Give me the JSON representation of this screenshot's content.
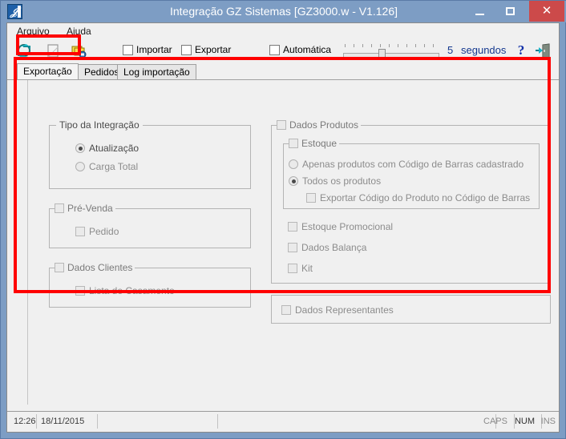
{
  "window": {
    "title": "Integração GZ Sistemas [GZ3000.w - V1.126]",
    "icon": "app-icon",
    "minimize_label": "",
    "maximize_label": "",
    "close_label": "✕"
  },
  "menu": {
    "items": [
      {
        "label": "Arquivo"
      },
      {
        "label": "Ajuda"
      }
    ]
  },
  "toolbar": {
    "icons": [
      {
        "name": "sync-icon"
      },
      {
        "name": "note-icon"
      },
      {
        "name": "copy-icon"
      }
    ],
    "checkboxes": [
      {
        "label": "Importar",
        "checked": false
      },
      {
        "label": "Exportar",
        "checked": false
      },
      {
        "label": "Automática",
        "checked": false
      }
    ],
    "slider": {
      "value": 5,
      "min": 1,
      "max": 12
    },
    "seconds_value": "5",
    "seconds_label": "segundos",
    "help_label": "?",
    "exit_label": ""
  },
  "tabs": [
    {
      "label": "Exportação",
      "active": true
    },
    {
      "label": "Pedidos",
      "active": false
    },
    {
      "label": "Log importação",
      "active": false
    }
  ],
  "exportacao": {
    "tipo_integracao": {
      "legend": "Tipo da Integração",
      "options": [
        {
          "label": "Atualização",
          "selected": true
        },
        {
          "label": "Carga Total",
          "selected": false
        }
      ]
    },
    "pre_venda": {
      "legend": "Pré-Venda",
      "checked": false,
      "options": [
        {
          "label": "Pedido",
          "checked": false
        }
      ]
    },
    "dados_clientes": {
      "legend": "Dados Clientes",
      "checked": false,
      "options": [
        {
          "label": "Lista de Casamento",
          "checked": false
        }
      ]
    },
    "dados_produtos": {
      "legend": "Dados Produtos",
      "checked": false,
      "estoque": {
        "legend": "Estoque",
        "checked": false,
        "radios": [
          {
            "label": "Apenas produtos com Código de Barras cadastrado",
            "selected": false
          },
          {
            "label": "Todos os produtos",
            "selected": true
          }
        ],
        "sub_checkbox": {
          "label": "Exportar Código do Produto no Código de Barras",
          "checked": false
        }
      },
      "options": [
        {
          "label": "Estoque Promocional",
          "checked": false
        },
        {
          "label": "Dados Balança",
          "checked": false
        },
        {
          "label": "Kit",
          "checked": false
        }
      ]
    },
    "dados_representantes": {
      "legend": "",
      "options": [
        {
          "label": "Dados Representantes",
          "checked": false
        }
      ]
    }
  },
  "statusbar": {
    "time": "12:26",
    "date": "18/11/2015",
    "caps": "CAPS",
    "num": "NUM",
    "ins": "INS"
  },
  "annotations": {
    "highlight_color": "#ff0000",
    "tab_highlight": "Exportação",
    "panel_highlight": "Exportação panel"
  },
  "colors": {
    "titlebar": "#7d9dc4",
    "close_button": "#cc4a4a",
    "surface": "#f0f0f0",
    "accent_text": "#15398f"
  }
}
